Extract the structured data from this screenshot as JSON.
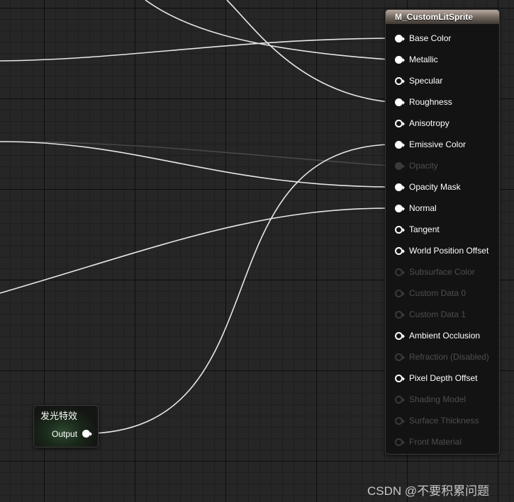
{
  "result_node": {
    "title": "M_CustomLitSprite",
    "pins": [
      {
        "label": "Base Color",
        "state": "connected"
      },
      {
        "label": "Metallic",
        "state": "connected"
      },
      {
        "label": "Specular",
        "state": "open"
      },
      {
        "label": "Roughness",
        "state": "connected"
      },
      {
        "label": "Anisotropy",
        "state": "open"
      },
      {
        "label": "Emissive Color",
        "state": "connected"
      },
      {
        "label": "Opacity",
        "state": "disabled"
      },
      {
        "label": "Opacity Mask",
        "state": "connected"
      },
      {
        "label": "Normal",
        "state": "connected"
      },
      {
        "label": "Tangent",
        "state": "open"
      },
      {
        "label": "World Position Offset",
        "state": "open"
      },
      {
        "label": "Subsurface Color",
        "state": "disabled-open"
      },
      {
        "label": "Custom Data 0",
        "state": "disabled-open"
      },
      {
        "label": "Custom Data 1",
        "state": "disabled-open"
      },
      {
        "label": "Ambient Occlusion",
        "state": "open"
      },
      {
        "label": "Refraction (Disabled)",
        "state": "disabled-open"
      },
      {
        "label": "Pixel Depth Offset",
        "state": "open"
      },
      {
        "label": "Shading Model",
        "state": "disabled-open"
      },
      {
        "label": "Surface Thickness",
        "state": "disabled-open"
      },
      {
        "label": "Front Material",
        "state": "disabled-open"
      }
    ]
  },
  "effect_node": {
    "title": "发光特效",
    "output_label": "Output"
  },
  "watermark": "CSDN @不要积累问题",
  "colors": {
    "graph_background": "#262626",
    "wire": "#e8e8e8",
    "header_brown": "#75695f",
    "disabled_text": "#4e4e4e"
  }
}
